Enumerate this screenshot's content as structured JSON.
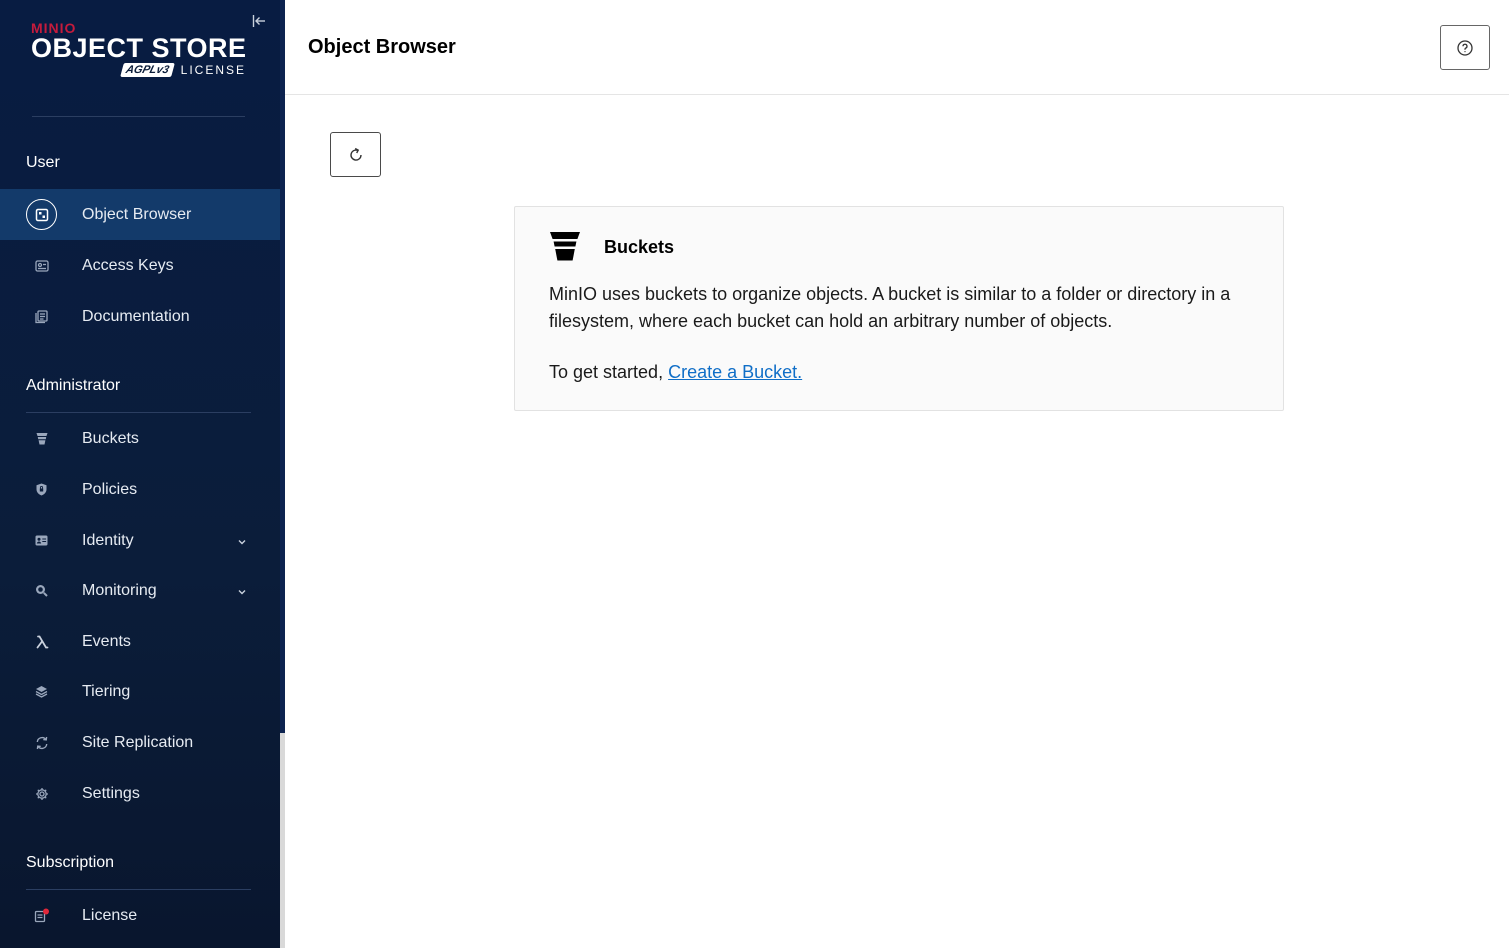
{
  "logo": {
    "brand": "MINIO",
    "product": "OBJECT STORE",
    "agpl": "AGPLv3",
    "license": "LICENSE"
  },
  "sidebar": {
    "sections": {
      "user": "User",
      "administrator": "Administrator",
      "subscription": "Subscription"
    },
    "items": {
      "object_browser": "Object Browser",
      "access_keys": "Access Keys",
      "documentation": "Documentation",
      "buckets": "Buckets",
      "policies": "Policies",
      "identity": "Identity",
      "monitoring": "Monitoring",
      "events": "Events",
      "tiering": "Tiering",
      "site_replication": "Site Replication",
      "settings": "Settings",
      "license": "License"
    },
    "active_item": "Object Browser"
  },
  "header": {
    "title": "Object Browser"
  },
  "card": {
    "title": "Buckets",
    "text": "MinIO uses buckets to organize objects. A bucket is similar to a folder or directory in a filesystem, where each bucket can hold an arbitrary number of objects.",
    "cta_prefix": "To get started, ",
    "cta_link": "Create a Bucket."
  },
  "colors": {
    "sidebar_bg": "#081c42",
    "active_item_bg": "#133a6a",
    "brand_red": "#c51b3c",
    "link": "#0f6ec7",
    "notification_dot": "#e0283a"
  },
  "icons": {
    "collapse": "collapse-sidebar-icon",
    "help": "help-icon",
    "refresh": "refresh-icon",
    "bucket": "bucket-icon"
  }
}
